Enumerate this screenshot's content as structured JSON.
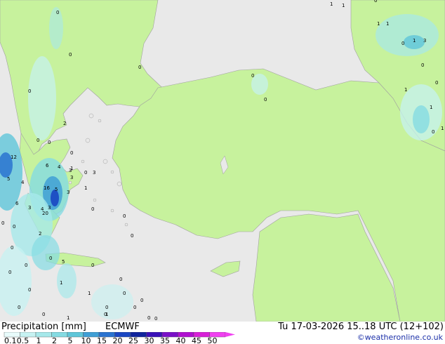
{
  "header": {
    "title": "Precipitation [mm]",
    "model": "ECMWF",
    "valid_time": "Tu 17-03-2026 15..18 UTC (12+102)",
    "credit": "©weatheronline.co.uk"
  },
  "legend": {
    "labels": [
      "0.1",
      "0.5",
      "1",
      "2",
      "5",
      "10",
      "15",
      "20",
      "25",
      "30",
      "35",
      "40",
      "45",
      "50"
    ],
    "colors": [
      "#e8fbfb",
      "#c6f2f2",
      "#a6e8ea",
      "#84dbe2",
      "#5fc6d9",
      "#3f9fd5",
      "#2a73d0",
      "#1a46c2",
      "#0f249c",
      "#3a10b8",
      "#7a10c8",
      "#b010d0",
      "#d820d8",
      "#f040f0"
    ]
  },
  "colors": {
    "land": "#c7f29d",
    "sea": "#e9e9e9",
    "border": "#a0a0a0"
  },
  "map_values": [
    "1",
    "1",
    "1",
    "3",
    "0",
    "0",
    "1",
    "1",
    "0",
    "1",
    "1",
    "0",
    "0",
    "0",
    "0",
    "0",
    "0",
    "12",
    "5",
    "4",
    "2",
    "1",
    "3",
    "0",
    "3",
    "6",
    "4",
    "16",
    "5",
    "3",
    "6",
    "3",
    "4",
    "3",
    "20",
    "0",
    "0",
    "2",
    "0",
    "0",
    "0",
    "0",
    "0",
    "5",
    "0",
    "1",
    "0",
    "0",
    "0",
    "0",
    "0",
    "1",
    "0",
    "0",
    "0",
    "0",
    "0",
    "0",
    "1",
    "0",
    "1",
    "0",
    "1",
    "0",
    "1",
    "0",
    "3",
    "0",
    "0",
    "0"
  ]
}
